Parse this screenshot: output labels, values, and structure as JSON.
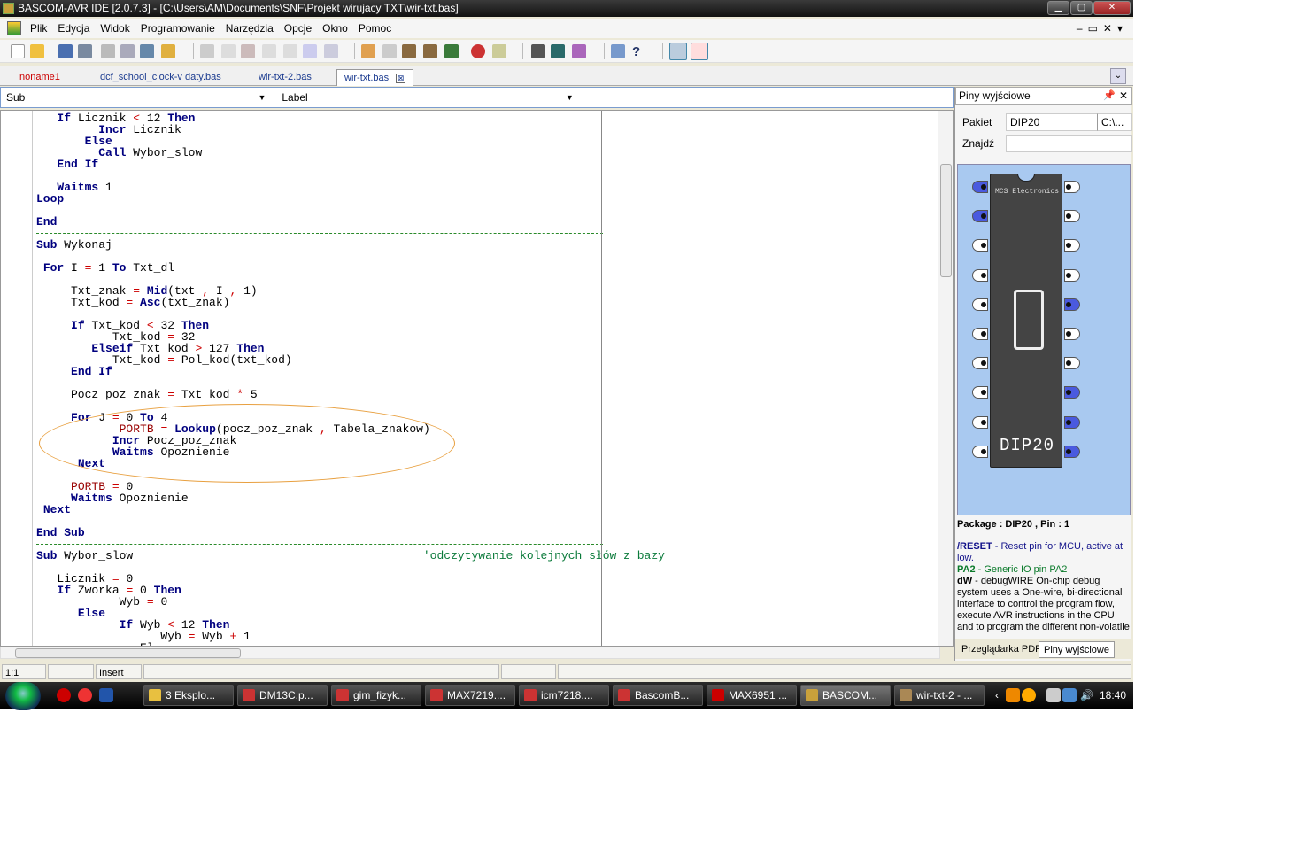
{
  "window": {
    "title": "BASCOM-AVR IDE [2.0.7.3] - [C:\\Users\\AM\\Documents\\SNF\\Projekt wirujacy TXT\\wir-txt.bas]"
  },
  "menu": [
    "Plik",
    "Edycja",
    "Widok",
    "Programowanie",
    "Narzędzia",
    "Opcje",
    "Okno",
    "Pomoc"
  ],
  "tabs": [
    "noname1",
    "dcf_school_clock-v daty.bas",
    "wir-txt-2.bas",
    "wir-txt.bas"
  ],
  "tab_close": "⊠",
  "subbar": {
    "sub_label": "Sub",
    "sub_value": "",
    "label_label": "Label",
    "label_value": ""
  },
  "code": [
    "   If Licznik < 12 Then",
    "         Incr Licznik",
    "       Else",
    "         Call Wybor_slow",
    "   End If",
    "",
    "   Waitms 1",
    "Loop",
    "",
    "End",
    "'---------------------------------------------------------------------------------",
    "Sub Wykonaj",
    "",
    " For I = 1 To Txt_dl",
    "",
    "     Txt_znak = Mid(txt , I , 1)",
    "     Txt_kod = Asc(txt_znak)",
    "",
    "     If Txt_kod < 32 Then",
    "           Txt_kod = 32",
    "        Elseif Txt_kod > 127 Then",
    "           Txt_kod = Pol_kod(txt_kod)",
    "     End If",
    "",
    "     Pocz_poz_znak = Txt_kod * 5",
    "",
    "     For J = 0 To 4",
    "            PORTB = Lookup(pocz_poz_znak , Tabela_znakow)",
    "           Incr Pocz_poz_znak",
    "           Waitms Opoznienie",
    "      Next",
    "",
    "     PORTB = 0",
    "     Waitms Opoznienie",
    " Next",
    "",
    "End Sub",
    "'---------------------------------------------------------------------------------",
    "Sub Wybor_slow                                          'odczytywanie kolejnych słów z bazy",
    "",
    "   Licznik = 0",
    "   If Zworka = 0 Then",
    "            Wyb = 0",
    "      Else",
    "            If Wyb < 12 Then",
    "                  Wyb = Wyb + 1",
    "               El"
  ],
  "status": {
    "position": "1:1",
    "mode": "Insert"
  },
  "panel": {
    "title": "Piny wyjściowe",
    "pakiet_label": "Pakiet",
    "pakiet_value": "DIP20",
    "pakiet_extra": "C:\\...",
    "znajdz_label": "Znajdź",
    "chip_maker": "MCS Electronics",
    "chip_package": "DIP20",
    "info_header": "Package : DIP20 , Pin : 1",
    "reset_name": "/RESET",
    "reset_desc": " - Reset pin for MCU, active at low.",
    "pa2_name": "PA2",
    "pa2_desc": " - Generic IO pin PA2",
    "dw_name": "dW",
    "dw_desc": " - debugWIRE On-chip debug system uses a One-wire, bi-directional interface to control the program flow, execute AVR instructions in the CPU and to program the different non-volatile",
    "tabs": [
      "Przeglądarka PDF",
      "Piny wyjściowe"
    ]
  },
  "taskbar": {
    "tasks": [
      "3 Eksplo...",
      "DM13C.p...",
      "gim_fizyk...",
      "MAX7219....",
      "icm7218....",
      "BascomB...",
      "MAX6951 ...",
      "BASCOM...",
      "wir-txt-2 - ..."
    ],
    "clock": "18:40"
  },
  "colors": {
    "keyword": "#00007f",
    "operator": "#cc0000",
    "comment": "#0a7a3a",
    "highlight_oval": "#e8a040",
    "chip_bg": "#a9c9f0",
    "pin_selected": "#4a5adf"
  }
}
